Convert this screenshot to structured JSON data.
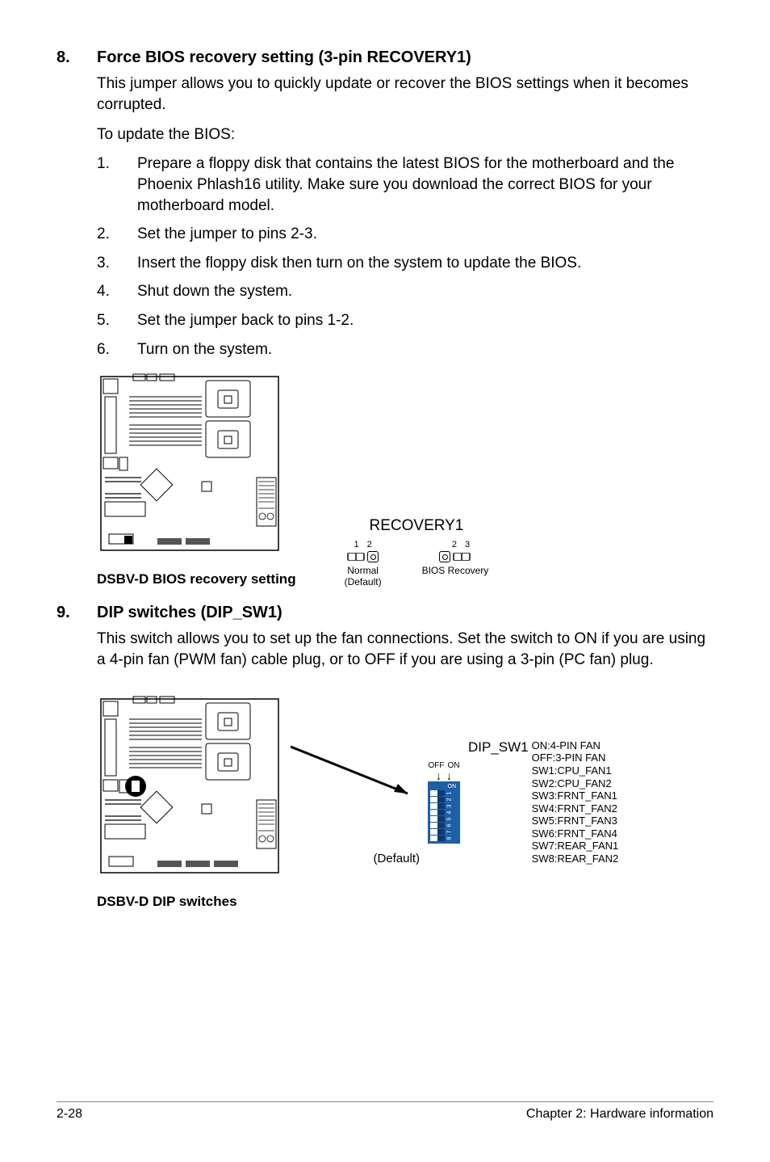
{
  "section8": {
    "number": "8.",
    "title": "Force BIOS recovery setting (3-pin RECOVERY1)",
    "intro": "This jumper allows you to quickly update or recover the BIOS settings when it becomes corrupted.",
    "subheading": "To update the BIOS:",
    "steps": [
      {
        "n": "1.",
        "t": "Prepare a floppy disk that contains the latest BIOS for the motherboard and the Phoenix Phlash16 utility. Make sure you download the correct BIOS for your motherboard model."
      },
      {
        "n": "2.",
        "t": "Set the jumper to pins 2-3."
      },
      {
        "n": "3.",
        "t": "Insert the floppy disk then turn on the system to update the BIOS."
      },
      {
        "n": "4.",
        "t": "Shut down the system."
      },
      {
        "n": "5.",
        "t": "Set the jumper back to pins 1-2."
      },
      {
        "n": "6.",
        "t": "Turn on the system."
      }
    ],
    "diagram_caption": "DSBV-D BIOS recovery setting",
    "jumper": {
      "name": "RECOVERY1",
      "left": {
        "pins": "1 2",
        "label1": "Normal",
        "label2": "(Default)"
      },
      "right": {
        "pins": "2 3",
        "label": "BIOS Recovery"
      }
    }
  },
  "section9": {
    "number": "9.",
    "title": "DIP switches (DIP_SW1)",
    "intro": "This switch allows you to set up the fan connections. Set the switch to ON if you are using a 4-pin fan (PWM fan) cable plug, or to OFF if you are using a 3-pin (PC fan) plug.",
    "diagram_caption": "DSBV-D DIP switches",
    "default_label": "(Default)",
    "off_label": "OFF",
    "on_label": "ON",
    "dip_name": "DIP_SW1",
    "legend_on": "ON:4-PIN FAN",
    "legend_off": "OFF:3-PIN FAN",
    "legend_lines": [
      "SW1:CPU_FAN1",
      "SW2:CPU_FAN2",
      "SW3:FRNT_FAN1",
      "SW4:FRNT_FAN2",
      "SW5:FRNT_FAN3",
      "SW6:FRNT_FAN4",
      "SW7:REAR_FAN1",
      "SW8:REAR_FAN2"
    ],
    "dip_on_text": "ON",
    "dip_numbers": [
      "1",
      "2",
      "3",
      "4",
      "5",
      "6",
      "7",
      "8"
    ]
  },
  "footer": {
    "page": "2-28",
    "chapter": "Chapter 2: Hardware information"
  }
}
